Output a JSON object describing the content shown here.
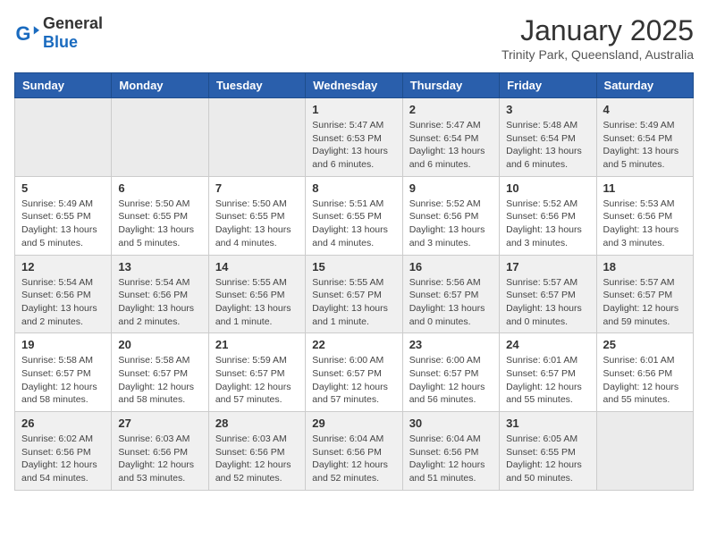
{
  "logo": {
    "general": "General",
    "blue": "Blue"
  },
  "title": "January 2025",
  "subtitle": "Trinity Park, Queensland, Australia",
  "days_of_week": [
    "Sunday",
    "Monday",
    "Tuesday",
    "Wednesday",
    "Thursday",
    "Friday",
    "Saturday"
  ],
  "weeks": [
    [
      {
        "day": "",
        "info": ""
      },
      {
        "day": "",
        "info": ""
      },
      {
        "day": "",
        "info": ""
      },
      {
        "day": "1",
        "info": "Sunrise: 5:47 AM\nSunset: 6:53 PM\nDaylight: 13 hours and 6 minutes."
      },
      {
        "day": "2",
        "info": "Sunrise: 5:47 AM\nSunset: 6:54 PM\nDaylight: 13 hours and 6 minutes."
      },
      {
        "day": "3",
        "info": "Sunrise: 5:48 AM\nSunset: 6:54 PM\nDaylight: 13 hours and 6 minutes."
      },
      {
        "day": "4",
        "info": "Sunrise: 5:49 AM\nSunset: 6:54 PM\nDaylight: 13 hours and 5 minutes."
      }
    ],
    [
      {
        "day": "5",
        "info": "Sunrise: 5:49 AM\nSunset: 6:55 PM\nDaylight: 13 hours and 5 minutes."
      },
      {
        "day": "6",
        "info": "Sunrise: 5:50 AM\nSunset: 6:55 PM\nDaylight: 13 hours and 5 minutes."
      },
      {
        "day": "7",
        "info": "Sunrise: 5:50 AM\nSunset: 6:55 PM\nDaylight: 13 hours and 4 minutes."
      },
      {
        "day": "8",
        "info": "Sunrise: 5:51 AM\nSunset: 6:55 PM\nDaylight: 13 hours and 4 minutes."
      },
      {
        "day": "9",
        "info": "Sunrise: 5:52 AM\nSunset: 6:56 PM\nDaylight: 13 hours and 3 minutes."
      },
      {
        "day": "10",
        "info": "Sunrise: 5:52 AM\nSunset: 6:56 PM\nDaylight: 13 hours and 3 minutes."
      },
      {
        "day": "11",
        "info": "Sunrise: 5:53 AM\nSunset: 6:56 PM\nDaylight: 13 hours and 3 minutes."
      }
    ],
    [
      {
        "day": "12",
        "info": "Sunrise: 5:54 AM\nSunset: 6:56 PM\nDaylight: 13 hours and 2 minutes."
      },
      {
        "day": "13",
        "info": "Sunrise: 5:54 AM\nSunset: 6:56 PM\nDaylight: 13 hours and 2 minutes."
      },
      {
        "day": "14",
        "info": "Sunrise: 5:55 AM\nSunset: 6:56 PM\nDaylight: 13 hours and 1 minute."
      },
      {
        "day": "15",
        "info": "Sunrise: 5:55 AM\nSunset: 6:57 PM\nDaylight: 13 hours and 1 minute."
      },
      {
        "day": "16",
        "info": "Sunrise: 5:56 AM\nSunset: 6:57 PM\nDaylight: 13 hours and 0 minutes."
      },
      {
        "day": "17",
        "info": "Sunrise: 5:57 AM\nSunset: 6:57 PM\nDaylight: 13 hours and 0 minutes."
      },
      {
        "day": "18",
        "info": "Sunrise: 5:57 AM\nSunset: 6:57 PM\nDaylight: 12 hours and 59 minutes."
      }
    ],
    [
      {
        "day": "19",
        "info": "Sunrise: 5:58 AM\nSunset: 6:57 PM\nDaylight: 12 hours and 58 minutes."
      },
      {
        "day": "20",
        "info": "Sunrise: 5:58 AM\nSunset: 6:57 PM\nDaylight: 12 hours and 58 minutes."
      },
      {
        "day": "21",
        "info": "Sunrise: 5:59 AM\nSunset: 6:57 PM\nDaylight: 12 hours and 57 minutes."
      },
      {
        "day": "22",
        "info": "Sunrise: 6:00 AM\nSunset: 6:57 PM\nDaylight: 12 hours and 57 minutes."
      },
      {
        "day": "23",
        "info": "Sunrise: 6:00 AM\nSunset: 6:57 PM\nDaylight: 12 hours and 56 minutes."
      },
      {
        "day": "24",
        "info": "Sunrise: 6:01 AM\nSunset: 6:57 PM\nDaylight: 12 hours and 55 minutes."
      },
      {
        "day": "25",
        "info": "Sunrise: 6:01 AM\nSunset: 6:56 PM\nDaylight: 12 hours and 55 minutes."
      }
    ],
    [
      {
        "day": "26",
        "info": "Sunrise: 6:02 AM\nSunset: 6:56 PM\nDaylight: 12 hours and 54 minutes."
      },
      {
        "day": "27",
        "info": "Sunrise: 6:03 AM\nSunset: 6:56 PM\nDaylight: 12 hours and 53 minutes."
      },
      {
        "day": "28",
        "info": "Sunrise: 6:03 AM\nSunset: 6:56 PM\nDaylight: 12 hours and 52 minutes."
      },
      {
        "day": "29",
        "info": "Sunrise: 6:04 AM\nSunset: 6:56 PM\nDaylight: 12 hours and 52 minutes."
      },
      {
        "day": "30",
        "info": "Sunrise: 6:04 AM\nSunset: 6:56 PM\nDaylight: 12 hours and 51 minutes."
      },
      {
        "day": "31",
        "info": "Sunrise: 6:05 AM\nSunset: 6:55 PM\nDaylight: 12 hours and 50 minutes."
      },
      {
        "day": "",
        "info": ""
      }
    ]
  ]
}
